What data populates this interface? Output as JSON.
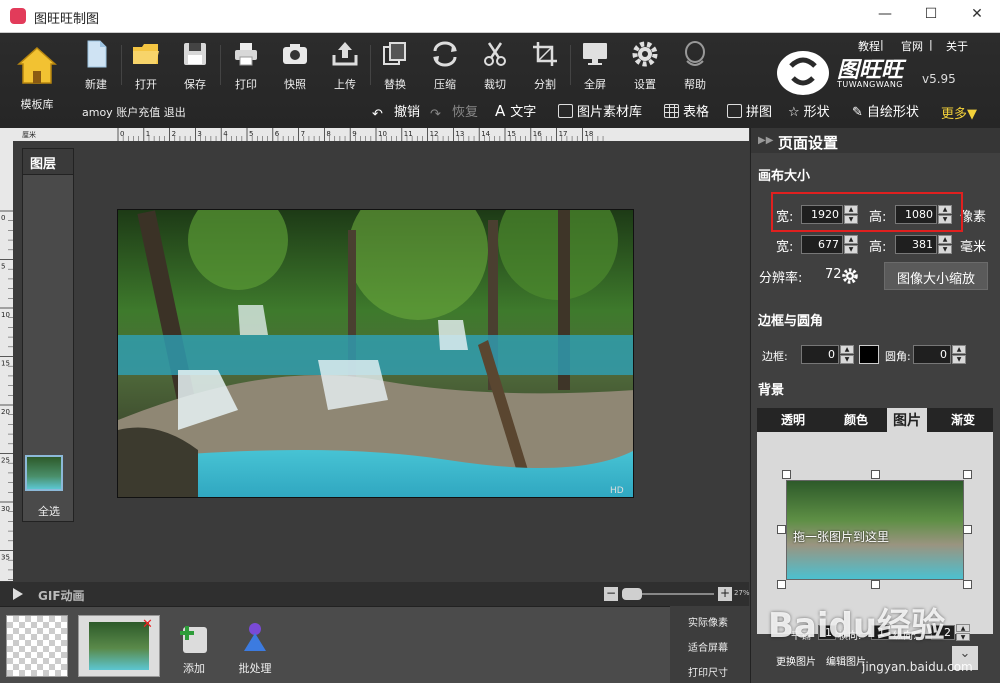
{
  "window": {
    "title": "图旺旺制图"
  },
  "toolbar": {
    "home": "模板库",
    "tools": [
      {
        "label": "新建",
        "icon": "new-file-icon"
      },
      {
        "label": "打开",
        "icon": "folder-icon"
      },
      {
        "label": "保存",
        "icon": "save-icon"
      },
      {
        "label": "打印",
        "icon": "printer-icon"
      },
      {
        "label": "快照",
        "icon": "camera-icon"
      },
      {
        "label": "上传",
        "icon": "upload-icon"
      },
      {
        "label": "替换",
        "icon": "replace-icon"
      },
      {
        "label": "压缩",
        "icon": "compress-icon"
      },
      {
        "label": "裁切",
        "icon": "scissors-icon"
      },
      {
        "label": "分割",
        "icon": "crop-icon"
      },
      {
        "label": "全屏",
        "icon": "monitor-icon"
      },
      {
        "label": "设置",
        "icon": "gear-icon"
      },
      {
        "label": "帮助",
        "icon": "help-icon"
      }
    ],
    "account": {
      "user": "amoy",
      "recharge": "账户充值",
      "logout": "退出"
    },
    "toplinks": [
      "教程",
      "官网",
      "关于"
    ],
    "logo": {
      "brand": "图旺旺",
      "sub": "TUWANGWANG",
      "version": "v5.95"
    },
    "subtools": [
      {
        "label": "撤销",
        "dim": false
      },
      {
        "label": "恢复",
        "dim": true
      },
      {
        "label": "文字",
        "dim": false
      },
      {
        "label": "图片素材库",
        "dim": false
      },
      {
        "label": "表格",
        "dim": false
      },
      {
        "label": "拼图",
        "dim": false
      },
      {
        "label": "形状",
        "dim": false
      },
      {
        "label": "自绘形状",
        "dim": false
      }
    ],
    "more": "更多▼"
  },
  "ruler": {
    "unit": "厘米",
    "h_ticks": [
      "0",
      "1",
      "2",
      "3",
      "4",
      "5",
      "6",
      "7",
      "8",
      "9",
      "10",
      "11",
      "12",
      "13",
      "14",
      "15",
      "16",
      "17",
      "18"
    ],
    "v_ticks": [
      "0",
      "5",
      "10",
      "15",
      "20",
      "25",
      "30",
      "35"
    ]
  },
  "layers": {
    "title": "图层",
    "select_all": "全选"
  },
  "statusbar": {
    "gif": "GIF动画",
    "zoom_percent": "27%"
  },
  "bottombar": {
    "add": "添加",
    "batch": "批处理",
    "actual_pixels": "实际像素",
    "fit_screen": "适合屏幕",
    "print_size": "打印尺寸"
  },
  "right_panel": {
    "header": "页面设置",
    "canvas_size": {
      "title": "画布大小",
      "width_label": "宽:",
      "height_label": "高:",
      "width_px": "1920",
      "height_px": "1080",
      "unit_px": "像素",
      "width_mm": "677",
      "height_mm": "381",
      "unit_mm": "毫米",
      "dpi_label": "分辨率:",
      "dpi": "72",
      "scale_button": "图像大小缩放"
    },
    "border": {
      "title": "边框与圆角",
      "border_label": "边框:",
      "border_value": "0",
      "radius_label": "圆角:",
      "radius_value": "0"
    },
    "background": {
      "title": "背景",
      "tabs": [
        "透明",
        "颜色",
        "图片",
        "渐变"
      ],
      "active_tab": "图片",
      "drop_hint": "拖一张图片到这里",
      "row_labels": [
        "平铺",
        "横向:",
        "纵向:"
      ],
      "row_values": [
        "1",
        "1",
        "2"
      ],
      "bottom_buttons": [
        "更换图片",
        "编辑图片"
      ]
    }
  },
  "watermark": {
    "text": "Baidu经验",
    "url": "jingyan.baidu.com"
  }
}
